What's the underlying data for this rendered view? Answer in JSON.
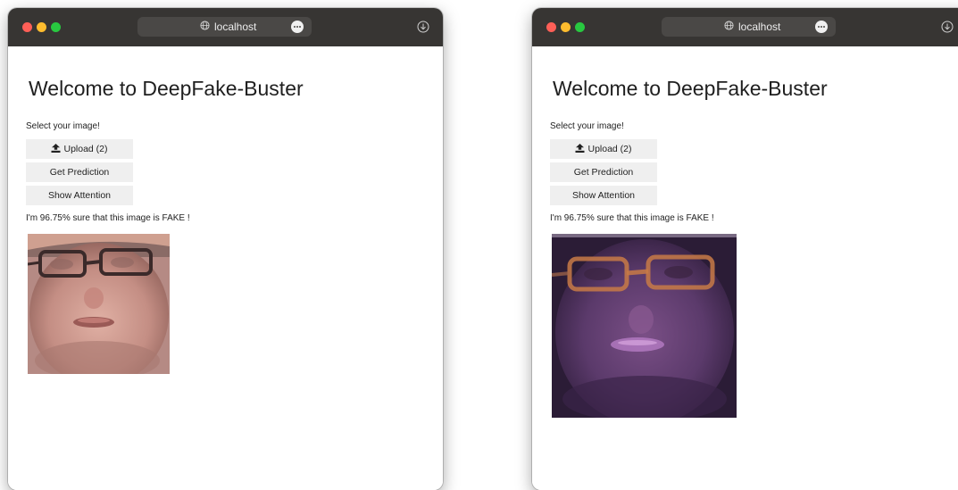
{
  "windows": [
    {
      "url": "localhost",
      "page": {
        "title": "Welcome to DeepFake-Buster",
        "select_label": "Select your image!",
        "buttons": {
          "upload": "Upload (2)",
          "predict": "Get Prediction",
          "attention": "Show Attention"
        },
        "result": "I'm 96.75% sure that this image is FAKE !",
        "image": "face-photo"
      }
    },
    {
      "url": "localhost",
      "page": {
        "title": "Welcome to DeepFake-Buster",
        "select_label": "Select your image!",
        "buttons": {
          "upload": "Upload (2)",
          "predict": "Get Prediction",
          "attention": "Show Attention"
        },
        "result": "I'm 96.75% sure that this image is FAKE !",
        "image": "attention-overlay-face"
      }
    }
  ],
  "colors": {
    "titlebar": "#373533",
    "urlbar": "#4a4846",
    "button_bg": "#efefef",
    "text": "#222222",
    "traffic_red": "#fe5f57",
    "traffic_yellow": "#febc2e",
    "traffic_green": "#28c840"
  }
}
